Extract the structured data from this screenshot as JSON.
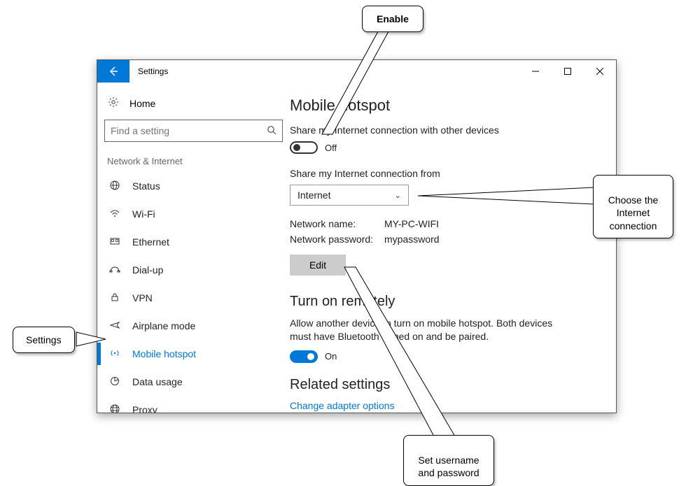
{
  "window": {
    "title": "Settings"
  },
  "sidebar": {
    "home": "Home",
    "search_placeholder": "Find a setting",
    "section": "Network & Internet",
    "items": [
      {
        "icon": "globe",
        "label": "Status"
      },
      {
        "icon": "wifi",
        "label": "Wi-Fi"
      },
      {
        "icon": "ethernet",
        "label": "Ethernet"
      },
      {
        "icon": "dialup",
        "label": "Dial-up"
      },
      {
        "icon": "vpn",
        "label": "VPN"
      },
      {
        "icon": "airplane",
        "label": "Airplane mode"
      },
      {
        "icon": "hotspot",
        "label": "Mobile hotspot"
      },
      {
        "icon": "datausage",
        "label": "Data usage"
      },
      {
        "icon": "proxy",
        "label": "Proxy"
      }
    ]
  },
  "main": {
    "heading": "Mobile hotspot",
    "share_text": "Share my Internet connection with other devices",
    "share_toggle_state": "Off",
    "share_from_label": "Share my Internet connection from",
    "share_from_value": "Internet",
    "network_name_label": "Network name:",
    "network_name_value": "MY-PC-WIFI",
    "network_password_label": "Network password:",
    "network_password_value": "mypassword",
    "edit_label": "Edit",
    "remote_heading": "Turn on remotely",
    "remote_desc": "Allow another device to turn on mobile hotspot. Both devices must have Bluetooth turned on and be paired.",
    "remote_toggle_state": "On",
    "related_heading": "Related settings",
    "related_link": "Change adapter options"
  },
  "callouts": {
    "enable": "Enable",
    "settings": "Settings",
    "choose_conn": "Choose the\nInternet\nconnection",
    "set_userpass": "Set username\nand password"
  }
}
